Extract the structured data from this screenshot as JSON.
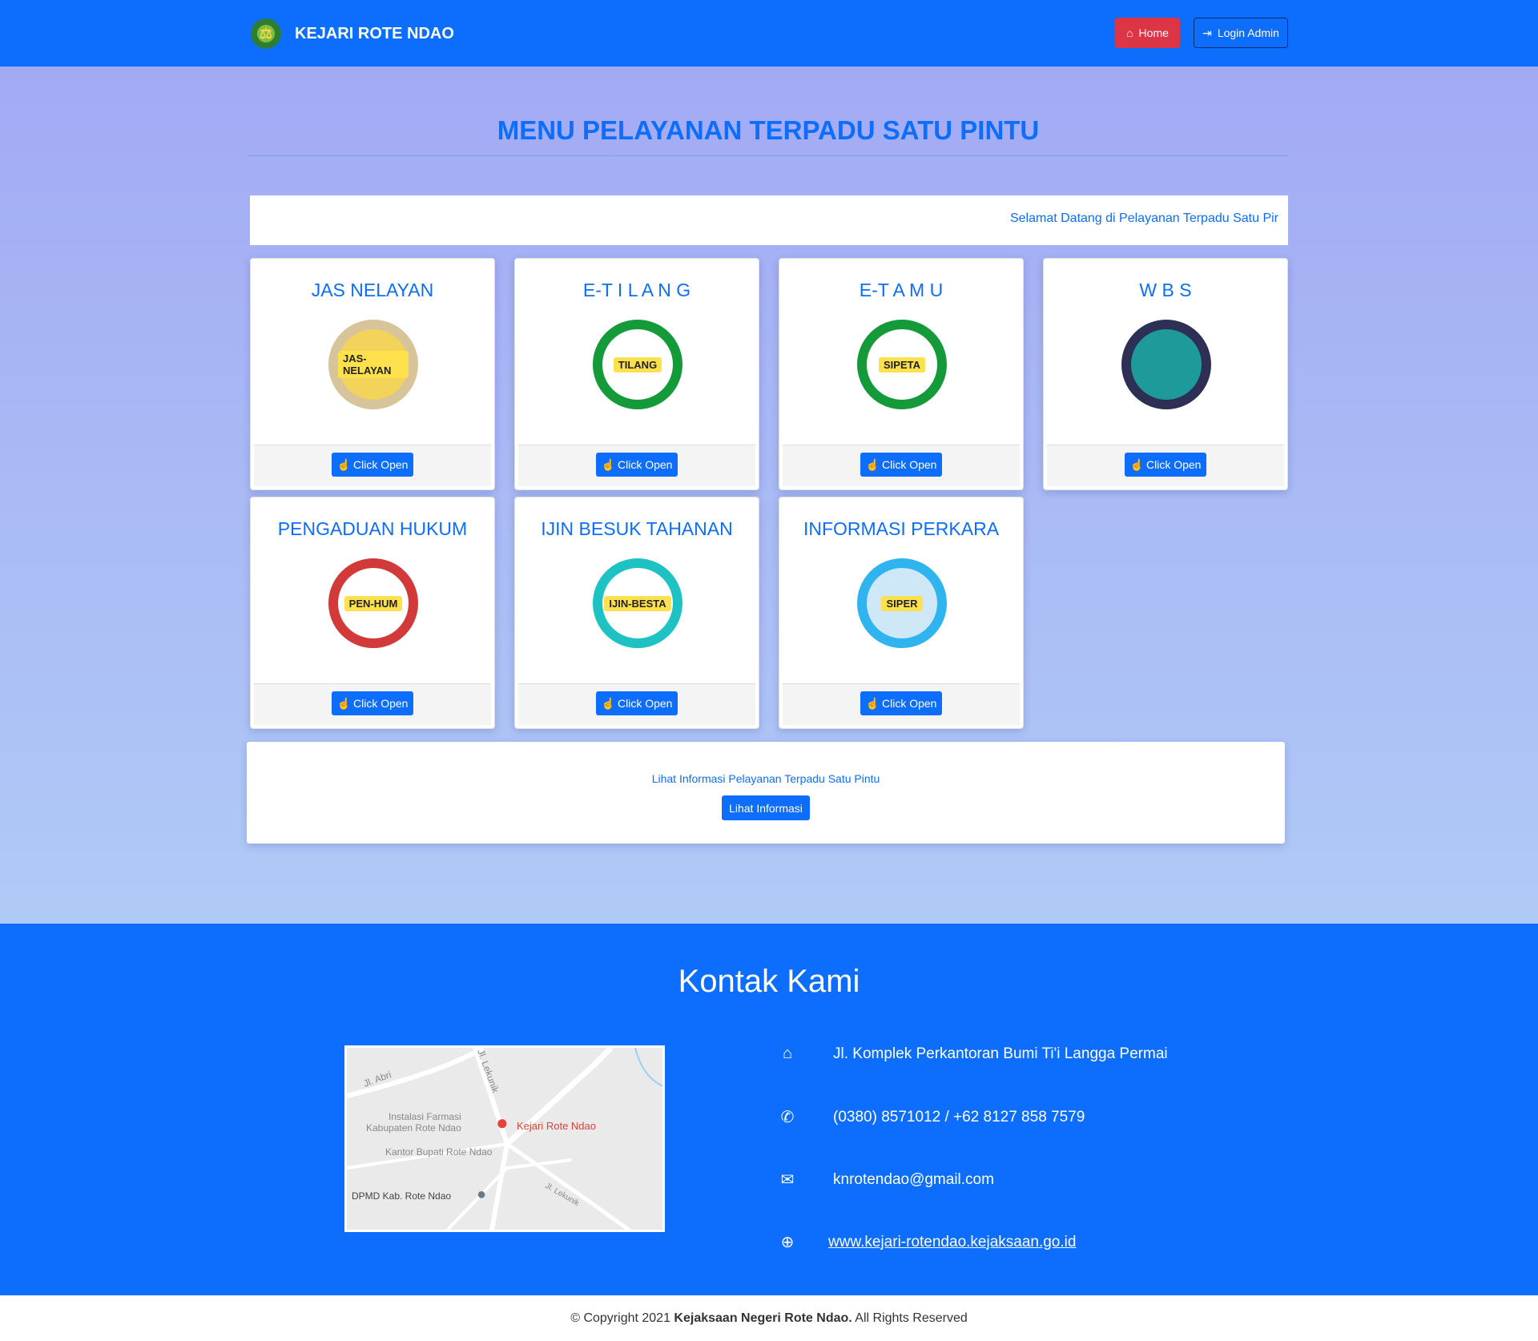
{
  "navbar": {
    "brand": "KEJARI ROTE NDAO",
    "home": "Home",
    "login": "Login Admin"
  },
  "page_title": "MENU PELAYANAN TERPADU SATU PINTU",
  "marquee": "Selamat Datang di Pelayanan Terpadu Satu Pir",
  "button_label": "Click Open",
  "services": [
    {
      "title": "JAS NELAYAN",
      "badge": "JAS-NELAYAN",
      "ring": "#d8c49a",
      "fill": "#f3d35a"
    },
    {
      "title": "E-T I L A N G",
      "badge": "TILANG",
      "ring": "#159a3a",
      "fill": "#fff"
    },
    {
      "title": "E-T A M U",
      "badge": "SIPETA",
      "ring": "#159a3a",
      "fill": "#fff"
    },
    {
      "title": "W B S",
      "badge": "",
      "ring": "#2d2f55",
      "fill": "#1e9a9a"
    },
    {
      "title": "PENGADUAN HUKUM",
      "badge": "PEN-HUM",
      "ring": "#d23a3a",
      "fill": "#fff"
    },
    {
      "title": "IJIN BESUK TAHANAN",
      "badge": "IJIN-BESTA",
      "ring": "#1ec2c2",
      "fill": "#fff"
    },
    {
      "title": "INFORMASI PERKARA",
      "badge": "SIPER",
      "ring": "#2fb4f0",
      "fill": "#cfe8f7"
    }
  ],
  "info": {
    "text": "Lihat Informasi Pelayanan Terpadu Satu Pintu",
    "button": "Lihat Informasi"
  },
  "contact": {
    "title": "Kontak Kami",
    "address": "Jl. Komplek Perkantoran Bumi Ti'i Langga Permai",
    "phone": "(0380) 8571012 / +62 8127 858 7579",
    "email": "knrotendao@gmail.com",
    "website": "www.kejari-rotendao.kejaksaan.go.id"
  },
  "map": {
    "labels": [
      "Jl. Abri",
      "Jl. Lekunik",
      "Instalasi Farmasi",
      "Kabupaten Rote Ndao",
      "Kejari Rote Ndao",
      "Kantor Bupati Rote Ndao",
      "DPMD Kab. Rote Ndao",
      "Jl. Lekunik"
    ]
  },
  "footer": {
    "prefix": "© Copyright 2021",
    "org": "Kejaksaan Negeri Rote Ndao.",
    "suffix": "All Rights Reserved"
  }
}
